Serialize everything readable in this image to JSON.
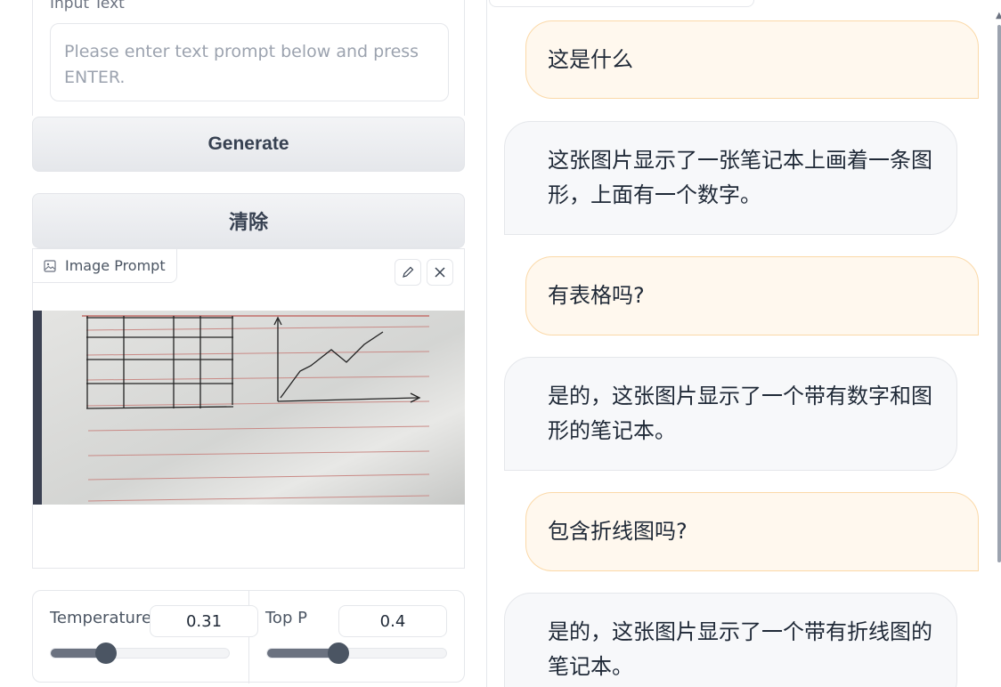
{
  "input": {
    "label": "Input Text",
    "placeholder": "Please enter text prompt below and press ENTER."
  },
  "buttons": {
    "generate": "Generate",
    "clear": "清除"
  },
  "image_prompt": {
    "label": "Image Prompt"
  },
  "params": {
    "temperature": {
      "label": "Temperature",
      "value": "0.31",
      "fraction": 0.31
    },
    "top_p": {
      "label": "Top P",
      "value": "0.4",
      "fraction": 0.4
    }
  },
  "chat": [
    {
      "role": "user",
      "text": "这是什么"
    },
    {
      "role": "bot",
      "text": "这张图片显示了一张笔记本上画着一条图形，上面有一个数字。"
    },
    {
      "role": "user",
      "text": "有表格吗?"
    },
    {
      "role": "bot",
      "text": "是的，这张图片显示了一个带有数字和图形的笔记本。"
    },
    {
      "role": "user",
      "text": "包含折线图吗?"
    },
    {
      "role": "bot",
      "text": "是的，这张图片显示了一个带有折线图的笔记本。"
    }
  ],
  "icons": [
    "image-icon",
    "pencil-icon",
    "close-icon"
  ]
}
